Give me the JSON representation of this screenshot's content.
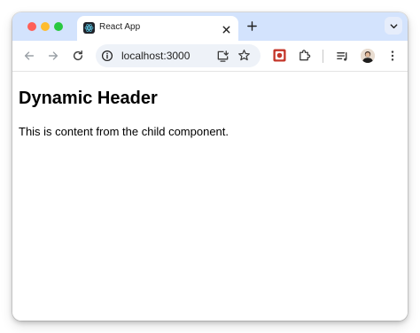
{
  "browser": {
    "tab": {
      "title": "React App",
      "favicon": "react-logo-icon"
    },
    "address_bar": {
      "url": "localhost:3000"
    },
    "icons": {
      "back": "arrow-left-icon",
      "forward": "arrow-right-icon",
      "reload": "reload-icon",
      "site_info": "info-icon",
      "install": "install-app-icon",
      "bookmark": "star-icon",
      "extension_app": "extension-app-icon",
      "extensions": "puzzle-icon",
      "reading_list": "reading-list-icon",
      "profile": "avatar",
      "menu": "kebab-menu-icon",
      "new_tab": "plus-icon",
      "tab_search": "chevron-down-icon",
      "close_tab": "close-icon"
    },
    "colors": {
      "tab_strip": "#d3e3fd",
      "omnibox": "#eef2f8",
      "traffic_red": "#ff5f57",
      "traffic_yellow": "#febc2e",
      "traffic_green": "#28c840"
    }
  },
  "page": {
    "heading": "Dynamic Header",
    "content": "This is content from the child component."
  }
}
